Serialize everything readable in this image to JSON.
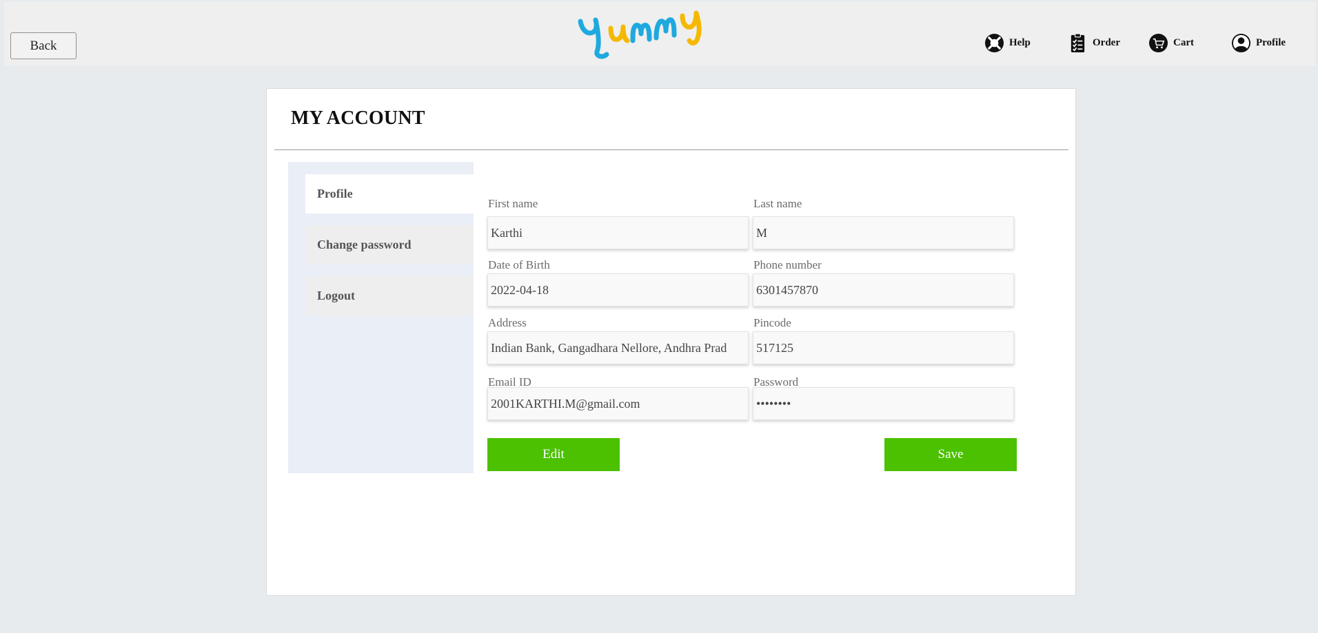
{
  "header": {
    "back_label": "Back",
    "brand": "yummy",
    "brand_colors": [
      "#1fa9de",
      "#f5b800"
    ],
    "nav": [
      {
        "label": "Help",
        "icon": "lifebuoy-icon"
      },
      {
        "label": "Order",
        "icon": "clipboard-icon"
      },
      {
        "label": "Cart",
        "icon": "cart-icon"
      },
      {
        "label": "Profile",
        "icon": "user-icon"
      }
    ]
  },
  "page": {
    "title": "MY ACCOUNT"
  },
  "sidebar": {
    "items": [
      {
        "label": "Profile",
        "active": true
      },
      {
        "label": "Change password",
        "active": false
      },
      {
        "label": "Logout",
        "active": false
      }
    ]
  },
  "form": {
    "first_name": {
      "label": "First name",
      "value": "Karthi"
    },
    "last_name": {
      "label": "Last name",
      "value": "M"
    },
    "dob": {
      "label": "Date of Birth",
      "value": "2022-04-18"
    },
    "phone": {
      "label": "Phone number",
      "value": "6301457870"
    },
    "address": {
      "label": "Address",
      "value": "Indian Bank, Gangadhara Nellore, Andhra Prad"
    },
    "pincode": {
      "label": "Pincode",
      "value": "517125"
    },
    "email": {
      "label": "Email ID",
      "value": "2001KARTHI.M@gmail.com"
    },
    "password": {
      "label": "Password",
      "value": "••••••••"
    },
    "edit_label": "Edit",
    "save_label": "Save"
  },
  "colors": {
    "accent": "#4bc102",
    "page_bg": "#e8ebee",
    "sidebar_bg": "#eaeef6"
  }
}
